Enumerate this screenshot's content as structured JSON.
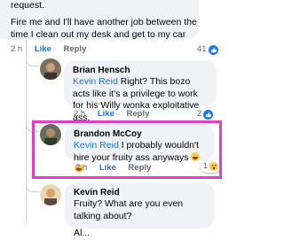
{
  "comment_top": {
    "text_line1": "request.",
    "text_line2": "Fire me and I'll have another job between the time I clean out my desk and get to my car",
    "time": "2 h",
    "like": "Like",
    "reply": "Reply",
    "reaction_count": "41"
  },
  "comment_brian": {
    "author": "Brian Hensch",
    "mention": "Kevin Reid",
    "text": " Right? This bozo acts like it's a privilege to work for his Willy wonka exploitative ass.",
    "time": "2 h",
    "like": "Like",
    "reply": "Reply",
    "reaction_count": "2"
  },
  "comment_brandon": {
    "author": "Brandon McCoy",
    "mention": "Kevin Reid",
    "text": " I probably wouldn't hire your fruity ass anyways",
    "time": "2 h",
    "like": "Like",
    "reply": "Reply",
    "reaction_count": "1"
  },
  "comment_kevin": {
    "author": "Kevin Reid",
    "text": "Fruity? What are you even talking about?",
    "text_cut": "Al..."
  },
  "colors": {
    "accent": "#1877f2",
    "highlight": "#e040c8",
    "bubble": "#f0f2f5"
  },
  "icons": [
    "thumbs-up-icon",
    "laugh-emoji-icon",
    "wow-emoji-icon",
    "avatar"
  ]
}
